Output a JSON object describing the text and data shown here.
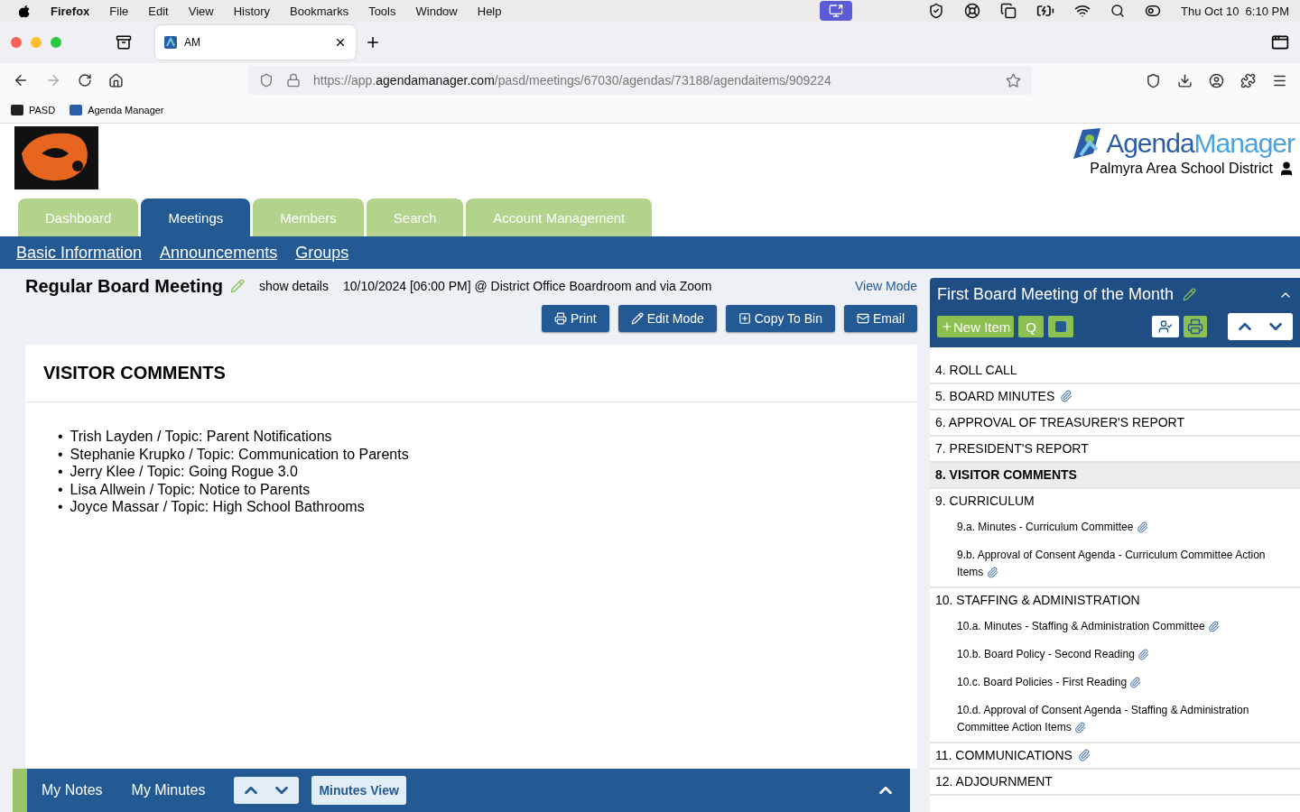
{
  "menubar": {
    "app": "Firefox",
    "items": [
      "File",
      "Edit",
      "View",
      "History",
      "Bookmarks",
      "Tools",
      "Window",
      "Help"
    ],
    "clock": "Thu Oct 10  6:10 PM"
  },
  "browser": {
    "tab_title": "AM",
    "url": {
      "host_start": "https://app.",
      "domain": "agendamanager.com",
      "path": "/pasd/meetings/67030/agendas/73188/agendaitems/909224"
    },
    "bookmarks": [
      "PASD",
      "Agenda Manager"
    ]
  },
  "header": {
    "brand": {
      "first": "Agenda",
      "second": "Manager"
    },
    "district": "Palmyra Area School District"
  },
  "tabs": [
    {
      "label": "Dashboard",
      "selected": false
    },
    {
      "label": "Meetings",
      "selected": true
    },
    {
      "label": "Members",
      "selected": false
    },
    {
      "label": "Search",
      "selected": false
    },
    {
      "label": "Account Management",
      "selected": false
    }
  ],
  "subnav": [
    "Basic Information",
    "Announcements",
    "Groups"
  ],
  "meeting": {
    "title": "Regular Board Meeting",
    "show_details": "show details",
    "when": "10/10/2024 [06:00 PM] @ District Office Boardroom and via Zoom",
    "view_mode": "View Mode",
    "buttons": [
      {
        "kind": "print",
        "label": "Print"
      },
      {
        "kind": "edit",
        "label": "Edit Mode"
      },
      {
        "kind": "copy",
        "label": "Copy To Bin"
      },
      {
        "kind": "email",
        "label": "Email"
      }
    ]
  },
  "content": {
    "heading": "VISITOR COMMENTS",
    "comments": [
      {
        "marker": "•",
        "text": "Trish Layden / Topic: Parent Notifications"
      },
      {
        "marker": "•",
        "text": "Stephanie Krupko / Topic: Communication to Parents"
      },
      {
        "marker": "•",
        "text": "Jerry Klee / Topic: Going Rogue 3.0"
      },
      {
        "marker": "•",
        "text": "Lisa Allwein / Topic: Notice to Parents"
      },
      {
        "marker": "•",
        "text": "Joyce Massar / Topic: High School Bathrooms"
      }
    ]
  },
  "agenda": {
    "title": "First Board Meeting of the Month",
    "new_item": "New Item",
    "quick": "Q",
    "items": [
      {
        "number": "4.",
        "title": "ROLL CALL",
        "attachment": false,
        "selected": false
      },
      {
        "number": "5.",
        "title": "BOARD MINUTES",
        "attachment": true,
        "selected": false
      },
      {
        "number": "6.",
        "title": "APPROVAL OF TREASURER'S REPORT",
        "attachment": false,
        "selected": false
      },
      {
        "number": "7.",
        "title": "PRESIDENT'S REPORT",
        "attachment": false,
        "selected": false
      },
      {
        "number": "8.",
        "title": "VISITOR COMMENTS",
        "attachment": false,
        "selected": true
      },
      {
        "number": "9.",
        "title": "CURRICULUM",
        "attachment": false,
        "selected": false,
        "children": [
          {
            "number": "9.a.",
            "title": "Minutes - Curriculum Committee",
            "attachment": true
          },
          {
            "number": "9.b.",
            "title": "Approval of Consent Agenda - Curriculum Committee Action Items",
            "attachment": true
          }
        ]
      },
      {
        "number": "10.",
        "title": "STAFFING & ADMINISTRATION",
        "attachment": false,
        "selected": false,
        "children": [
          {
            "number": "10.a.",
            "title": "Minutes - Staffing & Administration Committee",
            "attachment": true
          },
          {
            "number": "10.b.",
            "title": "Board Policy - Second Reading",
            "attachment": true
          },
          {
            "number": "10.c.",
            "title": "Board Policies - First Reading",
            "attachment": true
          },
          {
            "number": "10.d.",
            "title": "Approval of Consent Agenda - Staffing & Administration Committee Action Items",
            "attachment": true
          }
        ]
      },
      {
        "number": "11.",
        "title": "COMMUNICATIONS",
        "attachment": true,
        "selected": false
      },
      {
        "number": "12.",
        "title": "ADJOURNMENT",
        "attachment": false,
        "selected": false
      }
    ]
  },
  "bottom_bar": {
    "links": [
      "My Notes",
      "My Minutes"
    ],
    "minutes_view": "Minutes View"
  }
}
